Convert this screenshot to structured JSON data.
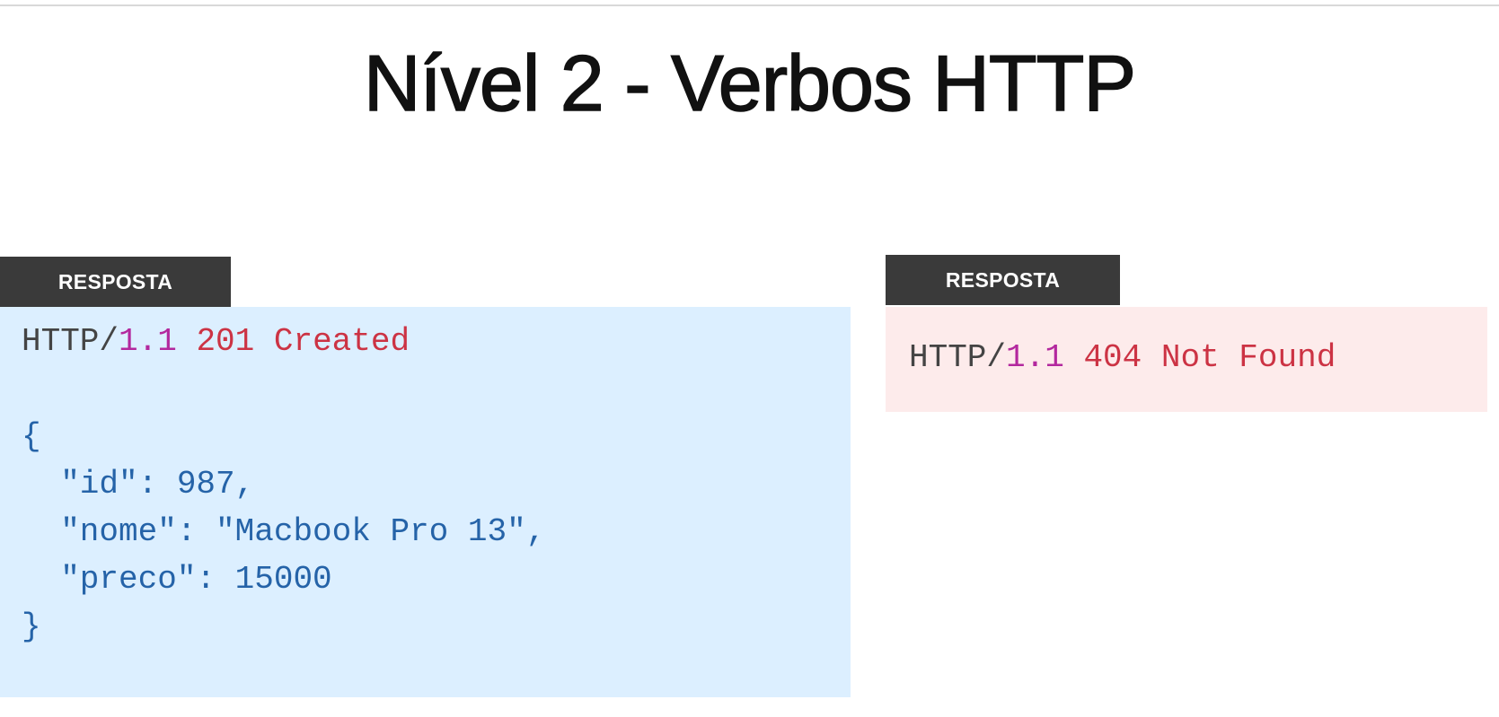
{
  "title": "Nível 2 - Verbos HTTP",
  "left_panel": {
    "tag": "RESPOSTA",
    "status_line": {
      "protocol": "HTTP/",
      "version": "1.1",
      "status": " 201 Created"
    },
    "body_lines": [
      "{",
      "  \"id\": 987,",
      "  \"nome\": \"Macbook Pro 13\",",
      "  \"preco\": 15000",
      "}"
    ]
  },
  "right_panel": {
    "tag": "RESPOSTA",
    "status_line": {
      "protocol": "HTTP/",
      "version": "1.1",
      "status": " 404 Not Found"
    }
  },
  "colors": {
    "left_box_bg": "#dcefff",
    "right_box_bg": "#fdebeb",
    "tag_bg": "#3a3a3a",
    "version": "#b3289e",
    "status": "#cc3344",
    "json": "#2563a8"
  }
}
